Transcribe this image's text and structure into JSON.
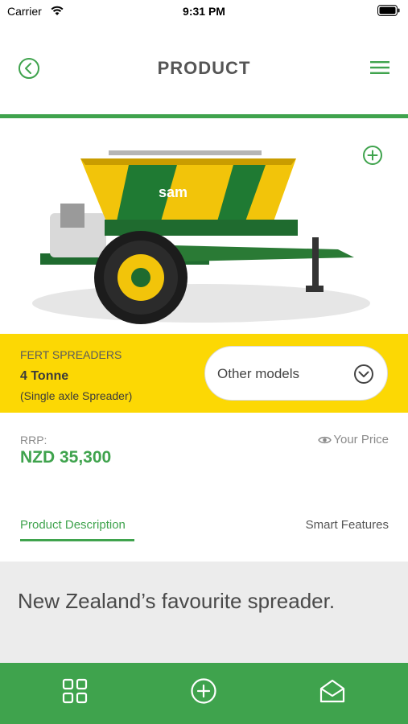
{
  "status_bar": {
    "carrier": "Carrier",
    "time": "9:31 PM",
    "icons": [
      "wifi-icon",
      "battery-icon"
    ]
  },
  "header": {
    "title": "PRODUCT",
    "back_icon": "chevron-left-circle-icon",
    "menu_icon": "hamburger-menu-icon"
  },
  "product": {
    "image_icon": "fertiliser-spreader-illustration",
    "brand_on_image": "sam",
    "add_icon": "plus-circle-icon",
    "category": "FERT SPREADERS",
    "name": "4 Tonne",
    "type": "(Single axle Spreader)",
    "other_models_label": "Other models",
    "other_models_icon": "chevron-down-circle-icon"
  },
  "pricing": {
    "rrp_label": "RRP:",
    "rrp_value": "NZD 35,300",
    "your_price_label": "Your Price",
    "your_price_icon": "eye-icon"
  },
  "tabs": [
    {
      "label": "Product Description",
      "active": true
    },
    {
      "label": "Smart Features",
      "active": false
    }
  ],
  "description": {
    "headline": "New Zealand’s favourite spreader."
  },
  "bottom_nav": {
    "items": [
      "grid-icon",
      "plus-circle-icon",
      "envelope-open-icon"
    ]
  },
  "colors": {
    "brand_green": "#3fa34d",
    "brand_yellow": "#fcd804",
    "panel_grey": "#ececec"
  }
}
